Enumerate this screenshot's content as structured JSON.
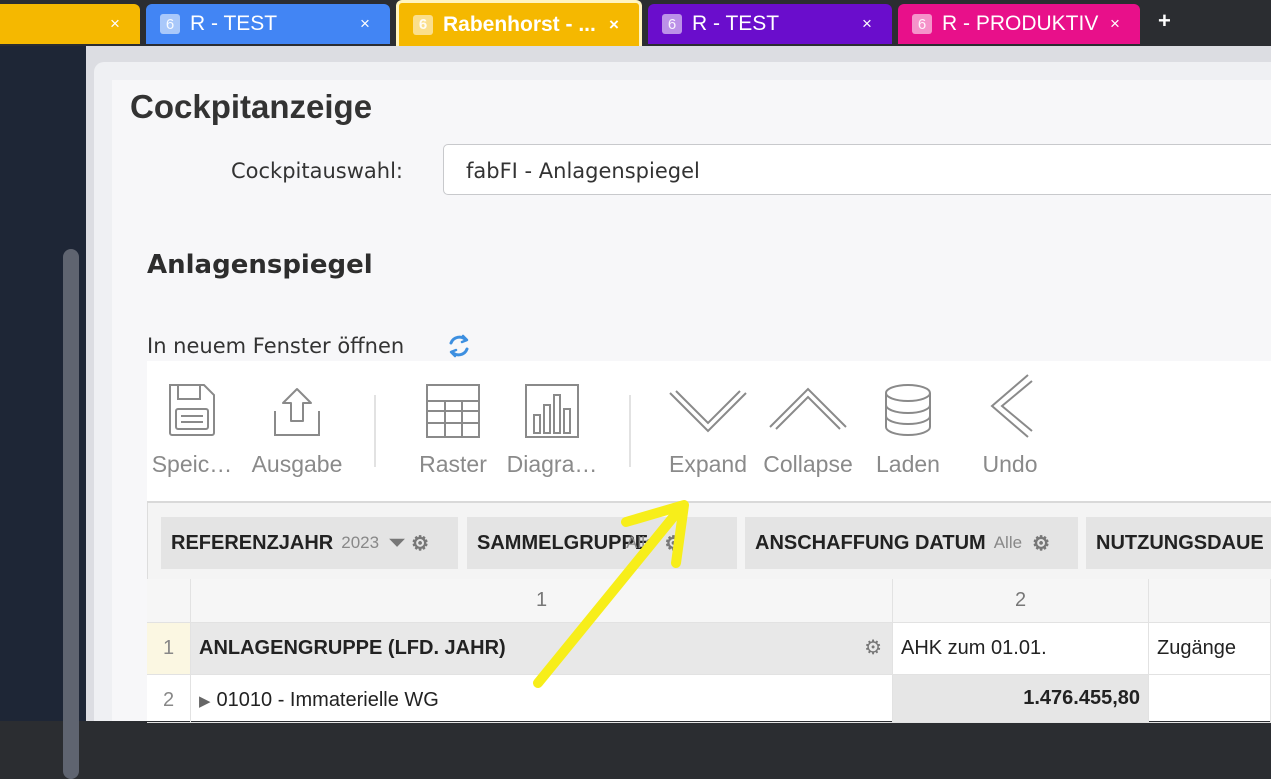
{
  "tabs": [
    {
      "label": "",
      "fav": "",
      "color": "#f5b800"
    },
    {
      "label": "R - TEST",
      "fav": "6",
      "color": "#4285f4"
    },
    {
      "label": "Rabenhorst - ...",
      "fav": "6",
      "color": "#f5b800"
    },
    {
      "label": "R - TEST",
      "fav": "6",
      "color": "#6a0dcc"
    },
    {
      "label": "R - PRODUKTIV",
      "fav": "6",
      "color": "#e8108a"
    }
  ],
  "tab_close": "×",
  "new_tab": "+",
  "page": {
    "title": "Cockpitanzeige",
    "selector_label": "Cockpitauswahl:",
    "selector_value": "fabFI - Anlagenspiegel",
    "section_title": "Anlagenspiegel",
    "open_new_window": "In neuem Fenster öffnen"
  },
  "toolbar": {
    "save": "Speic…",
    "output": "Ausgabe",
    "grid": "Raster",
    "chart": "Diagra…",
    "expand": "Expand",
    "collapse": "Collapse",
    "load": "Laden",
    "undo": "Undo"
  },
  "filters": [
    {
      "label": "REFERENZJAHR",
      "value": "2023"
    },
    {
      "label": "SAMMELGRUPPE",
      "value": "Alle"
    },
    {
      "label": "ANSCHAFFUNG DATUM",
      "value": "Alle"
    },
    {
      "label": "NUTZUNGSDAUE",
      "value": ""
    }
  ],
  "grid": {
    "col_headers": [
      "1",
      "2"
    ],
    "row_headers": [
      "1",
      "2"
    ],
    "header_row": {
      "group": "ANLAGENGRUPPE (LFD. JAHR)",
      "c1": "AHK zum 01.01.",
      "c2": "Zugänge"
    },
    "data_row": {
      "group": "01010 - Immaterielle WG",
      "c1": "1.476.455,80",
      "c2": ""
    }
  },
  "colors": {
    "annotation": "#f7ee1a",
    "refresh": "#3d8fe0"
  }
}
